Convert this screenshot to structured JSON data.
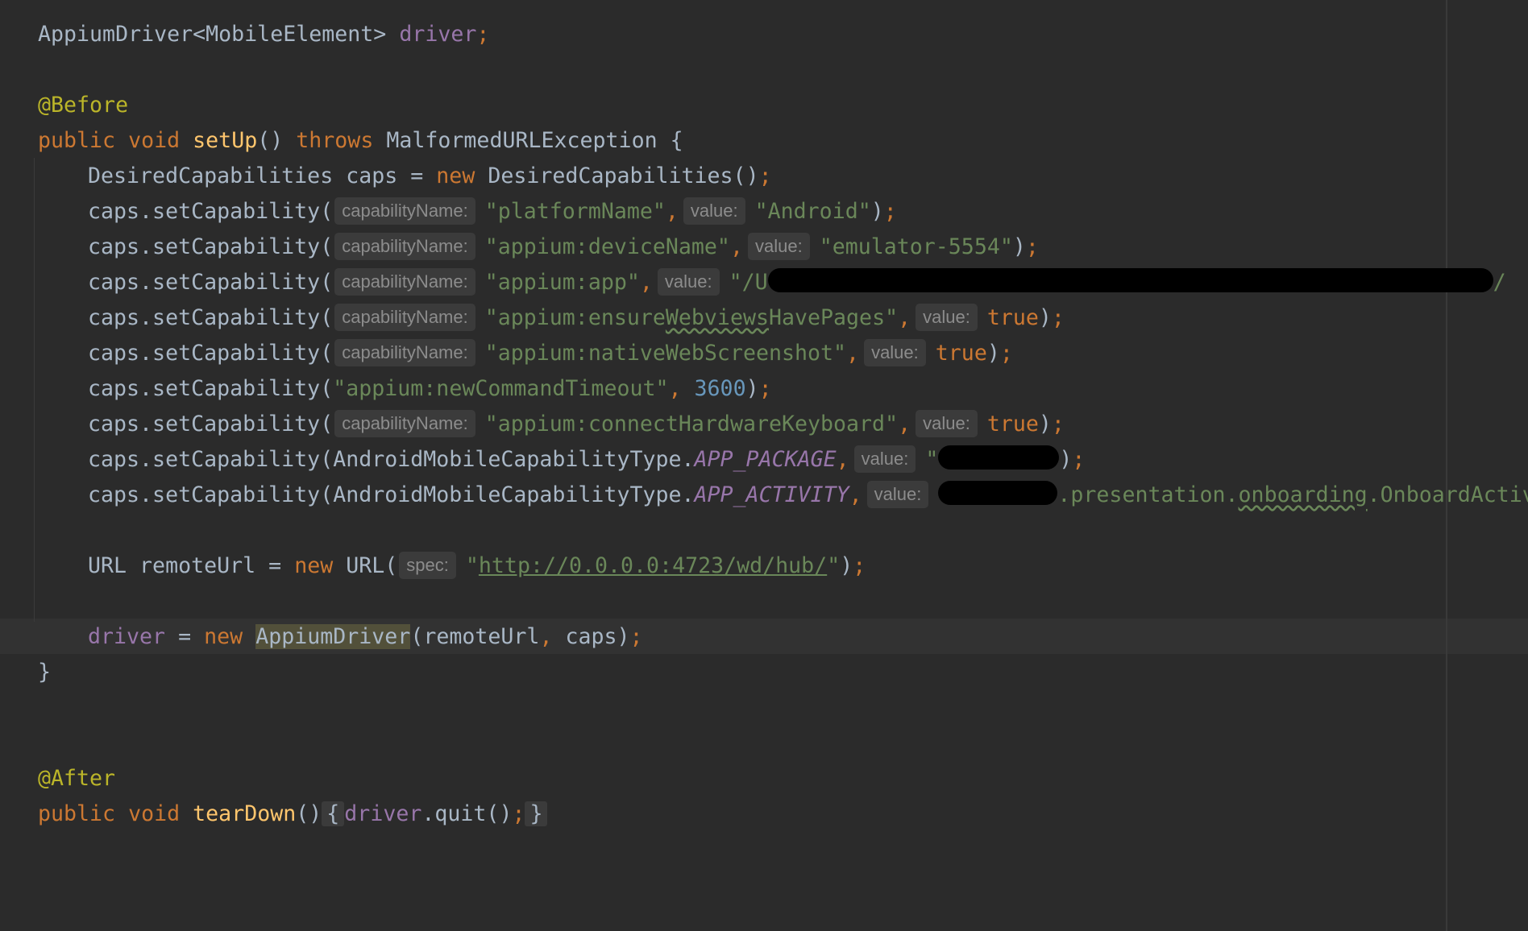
{
  "editor": {
    "lines": {
      "l1": {
        "type": "AppiumDriver<MobileElement>",
        "name": "driver",
        "semi": ";"
      },
      "l3": {
        "annotation": "@Before"
      },
      "l4": {
        "kw1": "public",
        "kw2": "void",
        "fn": "setUp",
        "parens": "()",
        "throws": "throws",
        "exc": "MalformedURLException",
        "brace": "{"
      },
      "l5": {
        "type": "DesiredCapabilities caps = ",
        "new": "new",
        "ctor": " DesiredCapabilities()",
        "semi": ";"
      },
      "l6": {
        "call": "caps.setCapability(",
        "hint1": "capabilityName:",
        "arg1": "\"platformName\"",
        "comma": ",",
        "hint2": "value:",
        "arg2": "\"Android\"",
        "end": ")",
        "semi": ";"
      },
      "l7": {
        "call": "caps.setCapability(",
        "hint1": "capabilityName:",
        "arg1": "\"appium:deviceName\"",
        "comma": ",",
        "hint2": "value:",
        "arg2": "\"emulator-5554\"",
        "end": ")",
        "semi": ";"
      },
      "l8": {
        "call": "caps.setCapability(",
        "hint1": "capabilityName:",
        "arg1": "\"appium:app\"",
        "comma": ",",
        "hint2": "value:",
        "arg2": "\"/U",
        "tail": "/"
      },
      "l9": {
        "call": "caps.setCapability(",
        "hint1": "capabilityName:",
        "arg1a": "\"appium:ensure",
        "arg1b": "Webviews",
        "arg1c": "HavePages\"",
        "comma": ",",
        "hint2": "value:",
        "arg2": "true",
        "end": ")",
        "semi": ";"
      },
      "l10": {
        "call": "caps.setCapability(",
        "hint1": "capabilityName:",
        "arg1": "\"appium:nativeWebScreenshot\"",
        "comma": ",",
        "hint2": "value:",
        "arg2": "true",
        "end": ")",
        "semi": ";"
      },
      "l11": {
        "call": "caps.setCapability(",
        "arg1": "\"appium:newCommandTimeout\"",
        "comma": ",",
        "num": "3600",
        "end": ")",
        "semi": ";"
      },
      "l12": {
        "call": "caps.setCapability(",
        "hint1": "capabilityName:",
        "arg1": "\"appium:connectHardwareKeyboard\"",
        "comma": ",",
        "hint2": "value:",
        "arg2": "true",
        "end": ")",
        "semi": ";"
      },
      "l13": {
        "call": "caps.setCapability(AndroidMobileCapabilityType.",
        "const": "APP_PACKAGE",
        "comma": ",",
        "hint2": "value:",
        "quote": "\"",
        "end": ")",
        "semi": ";"
      },
      "l14": {
        "call": "caps.setCapability(AndroidMobileCapabilityType.",
        "const": "APP_ACTIVITY",
        "comma": ",",
        "hint2": "value:",
        "arg2a": ".presentation.",
        "arg2b": "onboarding",
        "arg2c": ".OnboardActivity"
      },
      "l16": {
        "decl": "URL remoteUrl = ",
        "new": "new",
        "ctor": " URL(",
        "hint": "spec:",
        "q1": "\"",
        "url": "http://0.0.0.0:4723/wd/hub/",
        "q2": "\"",
        "end": ")",
        "semi": ";"
      },
      "l18": {
        "field": "driver",
        "assign": " = ",
        "new": "new",
        "ctor": "AppiumDriver",
        "args": "(remoteUrl",
        "comma": ",",
        "args2": " caps)",
        "semi": ";"
      },
      "l19": {
        "brace": "}"
      },
      "l22": {
        "annotation": "@After"
      },
      "l23": {
        "kw1": "public",
        "kw2": "void",
        "fn": "tearDown",
        "parens": "()",
        "fold_open": "{",
        "field": "driver",
        "call": ".quit()",
        "semi": ";",
        "fold_close": "}"
      }
    }
  },
  "colors": {
    "background": "#2b2b2b",
    "keyword": "#cc7832",
    "string": "#6a8759",
    "number": "#6897bb",
    "field": "#9876aa",
    "function": "#ffc66d",
    "annotation": "#bbb529",
    "text": "#a9b7c6"
  }
}
